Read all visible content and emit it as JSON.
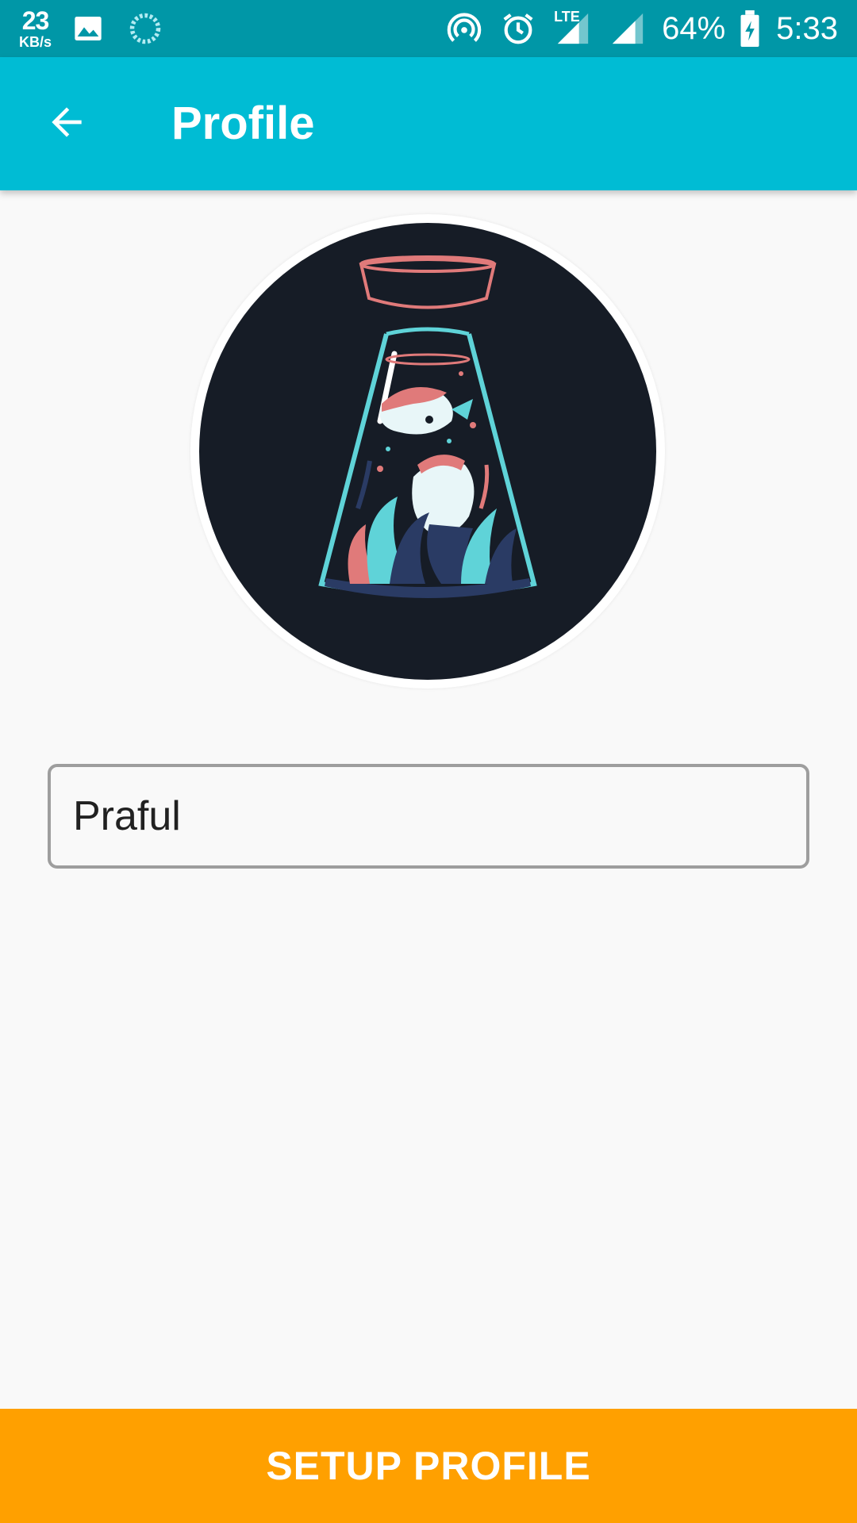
{
  "status_bar": {
    "net_speed_value": "23",
    "net_speed_unit": "KB/s",
    "network_type": "LTE",
    "battery_percent": "64%",
    "time": "5:33",
    "icons": [
      "image-icon",
      "sync-icon",
      "hotspot-icon",
      "alarm-icon",
      "lte-signal-icon",
      "signal-icon",
      "battery-charging-icon"
    ]
  },
  "app_bar": {
    "title": "Profile",
    "back_icon": "arrow-back-icon",
    "color": "#00bcd4"
  },
  "profile": {
    "avatar_icon": "avatar-image",
    "name_value": "Praful"
  },
  "actions": {
    "setup_label": "SETUP PROFILE",
    "setup_color": "#ffa000"
  }
}
